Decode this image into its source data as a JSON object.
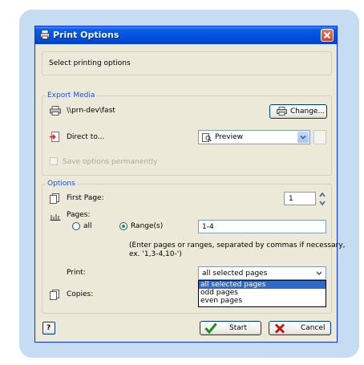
{
  "window": {
    "title": "Print Options"
  },
  "header": {
    "text": "Select printing options"
  },
  "export_media": {
    "legend": "Export Media",
    "printer_path": "\\\\prn-dev\\fast",
    "change_label": "Change...",
    "direct_to_label": "Direct to...",
    "direct_to_value": "Preview",
    "save_options_label": "Save options permanently"
  },
  "options": {
    "legend": "Options",
    "first_page_label": "First Page:",
    "first_page_value": "1",
    "pages_label": "Pages:",
    "all_label": "all",
    "ranges_label": "Range(s)",
    "ranges_value": "1-4",
    "help_line1": "(Enter pages or ranges, separated by commas if necessary,",
    "help_line2": "ex. '1,3-4,10-')",
    "print_label": "Print:",
    "print_value": "all selected pages",
    "print_options": [
      "all selected pages",
      "odd pages",
      "even pages"
    ],
    "copies_label": "Copies:"
  },
  "footer": {
    "start_label": "Start",
    "cancel_label": "Cancel"
  },
  "colors": {
    "titlebar": "#0054e3",
    "legend": "#2251c4",
    "selection": "#316ac5",
    "frame": "#c5dcf3"
  }
}
